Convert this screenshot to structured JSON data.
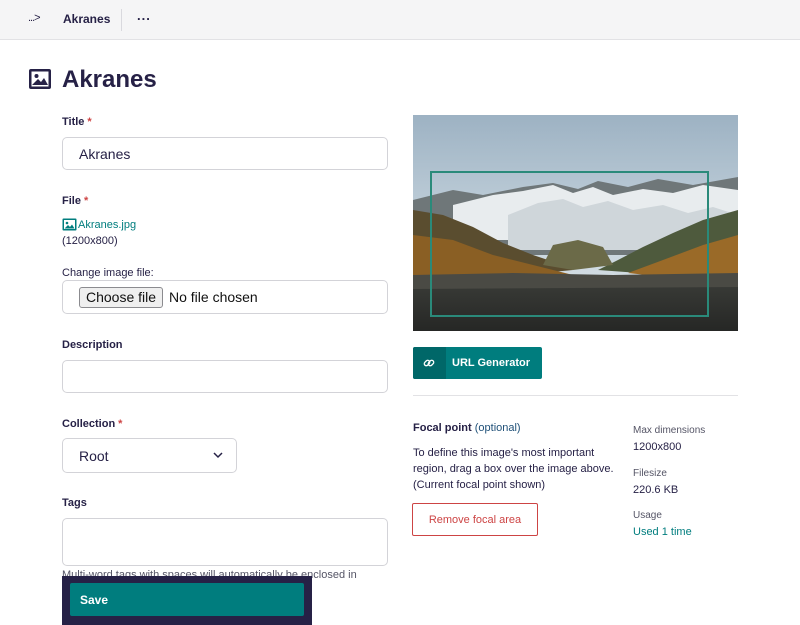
{
  "header": {
    "breadcrumb_icon": "...>",
    "breadcrumb_current": "Akranes",
    "more_label": "..."
  },
  "page": {
    "title": "Akranes",
    "title_icon": "image-icon"
  },
  "form": {
    "title_label": "Title",
    "title_value": "Akranes",
    "required_mark": "*",
    "file_label": "File",
    "file_name": "Akranes.jpg",
    "file_dims": "(1200x800)",
    "change_label": "Change image file:",
    "choose_button": "Choose file",
    "no_file_text": "No file chosen",
    "description_label": "Description",
    "description_value": "",
    "collection_label": "Collection",
    "collection_value": "Root",
    "tags_label": "Tags",
    "tags_value": "",
    "tags_help": "Multi-word tags with spaces will automatically be enclosed in",
    "save_label": "Save"
  },
  "preview": {
    "url_generator_label": "URL Generator",
    "focal_title": "Focal point",
    "focal_optional": "(optional)",
    "focal_desc_lines": [
      "To define this image's most important",
      "region, drag a box over the image above.",
      "(Current focal point shown)"
    ],
    "remove_focal_label": "Remove focal area"
  },
  "meta": {
    "max_dimensions_label": "Max dimensions",
    "max_dimensions_value": "1200x800",
    "filesize_label": "Filesize",
    "filesize_value": "220.6 KB",
    "usage_label": "Usage",
    "usage_value": "Used 1 time"
  },
  "colors": {
    "accent": "#007d7e",
    "primary_text": "#262146",
    "required": "#cd4444"
  }
}
